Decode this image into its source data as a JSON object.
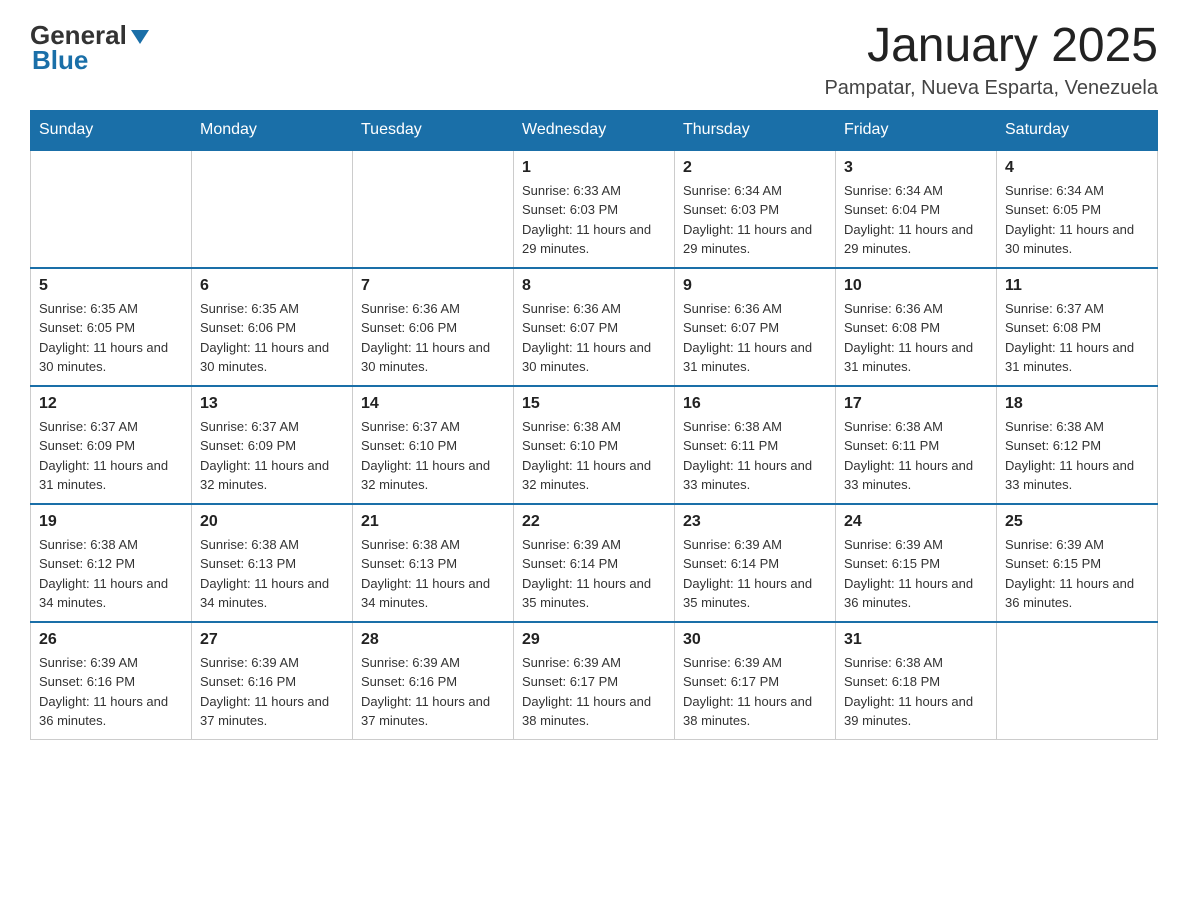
{
  "header": {
    "logo_general": "General",
    "logo_blue": "Blue",
    "title": "January 2025",
    "location": "Pampatar, Nueva Esparta, Venezuela"
  },
  "weekdays": [
    "Sunday",
    "Monday",
    "Tuesday",
    "Wednesday",
    "Thursday",
    "Friday",
    "Saturday"
  ],
  "weeks": [
    [
      {
        "day": "",
        "info": ""
      },
      {
        "day": "",
        "info": ""
      },
      {
        "day": "",
        "info": ""
      },
      {
        "day": "1",
        "info": "Sunrise: 6:33 AM\nSunset: 6:03 PM\nDaylight: 11 hours and 29 minutes."
      },
      {
        "day": "2",
        "info": "Sunrise: 6:34 AM\nSunset: 6:03 PM\nDaylight: 11 hours and 29 minutes."
      },
      {
        "day": "3",
        "info": "Sunrise: 6:34 AM\nSunset: 6:04 PM\nDaylight: 11 hours and 29 minutes."
      },
      {
        "day": "4",
        "info": "Sunrise: 6:34 AM\nSunset: 6:05 PM\nDaylight: 11 hours and 30 minutes."
      }
    ],
    [
      {
        "day": "5",
        "info": "Sunrise: 6:35 AM\nSunset: 6:05 PM\nDaylight: 11 hours and 30 minutes."
      },
      {
        "day": "6",
        "info": "Sunrise: 6:35 AM\nSunset: 6:06 PM\nDaylight: 11 hours and 30 minutes."
      },
      {
        "day": "7",
        "info": "Sunrise: 6:36 AM\nSunset: 6:06 PM\nDaylight: 11 hours and 30 minutes."
      },
      {
        "day": "8",
        "info": "Sunrise: 6:36 AM\nSunset: 6:07 PM\nDaylight: 11 hours and 30 minutes."
      },
      {
        "day": "9",
        "info": "Sunrise: 6:36 AM\nSunset: 6:07 PM\nDaylight: 11 hours and 31 minutes."
      },
      {
        "day": "10",
        "info": "Sunrise: 6:36 AM\nSunset: 6:08 PM\nDaylight: 11 hours and 31 minutes."
      },
      {
        "day": "11",
        "info": "Sunrise: 6:37 AM\nSunset: 6:08 PM\nDaylight: 11 hours and 31 minutes."
      }
    ],
    [
      {
        "day": "12",
        "info": "Sunrise: 6:37 AM\nSunset: 6:09 PM\nDaylight: 11 hours and 31 minutes."
      },
      {
        "day": "13",
        "info": "Sunrise: 6:37 AM\nSunset: 6:09 PM\nDaylight: 11 hours and 32 minutes."
      },
      {
        "day": "14",
        "info": "Sunrise: 6:37 AM\nSunset: 6:10 PM\nDaylight: 11 hours and 32 minutes."
      },
      {
        "day": "15",
        "info": "Sunrise: 6:38 AM\nSunset: 6:10 PM\nDaylight: 11 hours and 32 minutes."
      },
      {
        "day": "16",
        "info": "Sunrise: 6:38 AM\nSunset: 6:11 PM\nDaylight: 11 hours and 33 minutes."
      },
      {
        "day": "17",
        "info": "Sunrise: 6:38 AM\nSunset: 6:11 PM\nDaylight: 11 hours and 33 minutes."
      },
      {
        "day": "18",
        "info": "Sunrise: 6:38 AM\nSunset: 6:12 PM\nDaylight: 11 hours and 33 minutes."
      }
    ],
    [
      {
        "day": "19",
        "info": "Sunrise: 6:38 AM\nSunset: 6:12 PM\nDaylight: 11 hours and 34 minutes."
      },
      {
        "day": "20",
        "info": "Sunrise: 6:38 AM\nSunset: 6:13 PM\nDaylight: 11 hours and 34 minutes."
      },
      {
        "day": "21",
        "info": "Sunrise: 6:38 AM\nSunset: 6:13 PM\nDaylight: 11 hours and 34 minutes."
      },
      {
        "day": "22",
        "info": "Sunrise: 6:39 AM\nSunset: 6:14 PM\nDaylight: 11 hours and 35 minutes."
      },
      {
        "day": "23",
        "info": "Sunrise: 6:39 AM\nSunset: 6:14 PM\nDaylight: 11 hours and 35 minutes."
      },
      {
        "day": "24",
        "info": "Sunrise: 6:39 AM\nSunset: 6:15 PM\nDaylight: 11 hours and 36 minutes."
      },
      {
        "day": "25",
        "info": "Sunrise: 6:39 AM\nSunset: 6:15 PM\nDaylight: 11 hours and 36 minutes."
      }
    ],
    [
      {
        "day": "26",
        "info": "Sunrise: 6:39 AM\nSunset: 6:16 PM\nDaylight: 11 hours and 36 minutes."
      },
      {
        "day": "27",
        "info": "Sunrise: 6:39 AM\nSunset: 6:16 PM\nDaylight: 11 hours and 37 minutes."
      },
      {
        "day": "28",
        "info": "Sunrise: 6:39 AM\nSunset: 6:16 PM\nDaylight: 11 hours and 37 minutes."
      },
      {
        "day": "29",
        "info": "Sunrise: 6:39 AM\nSunset: 6:17 PM\nDaylight: 11 hours and 38 minutes."
      },
      {
        "day": "30",
        "info": "Sunrise: 6:39 AM\nSunset: 6:17 PM\nDaylight: 11 hours and 38 minutes."
      },
      {
        "day": "31",
        "info": "Sunrise: 6:38 AM\nSunset: 6:18 PM\nDaylight: 11 hours and 39 minutes."
      },
      {
        "day": "",
        "info": ""
      }
    ]
  ]
}
